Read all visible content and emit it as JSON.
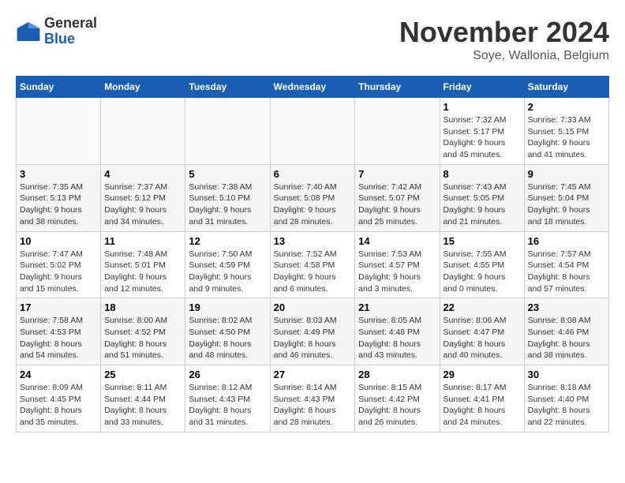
{
  "logo": {
    "general": "General",
    "blue": "Blue"
  },
  "title": "November 2024",
  "location": "Soye, Wallonia, Belgium",
  "days_of_week": [
    "Sunday",
    "Monday",
    "Tuesday",
    "Wednesday",
    "Thursday",
    "Friday",
    "Saturday"
  ],
  "weeks": [
    [
      {
        "day": "",
        "info": ""
      },
      {
        "day": "",
        "info": ""
      },
      {
        "day": "",
        "info": ""
      },
      {
        "day": "",
        "info": ""
      },
      {
        "day": "",
        "info": ""
      },
      {
        "day": "1",
        "info": "Sunrise: 7:32 AM\nSunset: 5:17 PM\nDaylight: 9 hours and 45 minutes."
      },
      {
        "day": "2",
        "info": "Sunrise: 7:33 AM\nSunset: 5:15 PM\nDaylight: 9 hours and 41 minutes."
      }
    ],
    [
      {
        "day": "3",
        "info": "Sunrise: 7:35 AM\nSunset: 5:13 PM\nDaylight: 9 hours and 38 minutes."
      },
      {
        "day": "4",
        "info": "Sunrise: 7:37 AM\nSunset: 5:12 PM\nDaylight: 9 hours and 34 minutes."
      },
      {
        "day": "5",
        "info": "Sunrise: 7:38 AM\nSunset: 5:10 PM\nDaylight: 9 hours and 31 minutes."
      },
      {
        "day": "6",
        "info": "Sunrise: 7:40 AM\nSunset: 5:08 PM\nDaylight: 9 hours and 28 minutes."
      },
      {
        "day": "7",
        "info": "Sunrise: 7:42 AM\nSunset: 5:07 PM\nDaylight: 9 hours and 25 minutes."
      },
      {
        "day": "8",
        "info": "Sunrise: 7:43 AM\nSunset: 5:05 PM\nDaylight: 9 hours and 21 minutes."
      },
      {
        "day": "9",
        "info": "Sunrise: 7:45 AM\nSunset: 5:04 PM\nDaylight: 9 hours and 18 minutes."
      }
    ],
    [
      {
        "day": "10",
        "info": "Sunrise: 7:47 AM\nSunset: 5:02 PM\nDaylight: 9 hours and 15 minutes."
      },
      {
        "day": "11",
        "info": "Sunrise: 7:48 AM\nSunset: 5:01 PM\nDaylight: 9 hours and 12 minutes."
      },
      {
        "day": "12",
        "info": "Sunrise: 7:50 AM\nSunset: 4:59 PM\nDaylight: 9 hours and 9 minutes."
      },
      {
        "day": "13",
        "info": "Sunrise: 7:52 AM\nSunset: 4:58 PM\nDaylight: 9 hours and 6 minutes."
      },
      {
        "day": "14",
        "info": "Sunrise: 7:53 AM\nSunset: 4:57 PM\nDaylight: 9 hours and 3 minutes."
      },
      {
        "day": "15",
        "info": "Sunrise: 7:55 AM\nSunset: 4:55 PM\nDaylight: 9 hours and 0 minutes."
      },
      {
        "day": "16",
        "info": "Sunrise: 7:57 AM\nSunset: 4:54 PM\nDaylight: 8 hours and 57 minutes."
      }
    ],
    [
      {
        "day": "17",
        "info": "Sunrise: 7:58 AM\nSunset: 4:53 PM\nDaylight: 8 hours and 54 minutes."
      },
      {
        "day": "18",
        "info": "Sunrise: 8:00 AM\nSunset: 4:52 PM\nDaylight: 8 hours and 51 minutes."
      },
      {
        "day": "19",
        "info": "Sunrise: 8:02 AM\nSunset: 4:50 PM\nDaylight: 8 hours and 48 minutes."
      },
      {
        "day": "20",
        "info": "Sunrise: 8:03 AM\nSunset: 4:49 PM\nDaylight: 8 hours and 46 minutes."
      },
      {
        "day": "21",
        "info": "Sunrise: 8:05 AM\nSunset: 4:48 PM\nDaylight: 8 hours and 43 minutes."
      },
      {
        "day": "22",
        "info": "Sunrise: 8:06 AM\nSunset: 4:47 PM\nDaylight: 8 hours and 40 minutes."
      },
      {
        "day": "23",
        "info": "Sunrise: 8:08 AM\nSunset: 4:46 PM\nDaylight: 8 hours and 38 minutes."
      }
    ],
    [
      {
        "day": "24",
        "info": "Sunrise: 8:09 AM\nSunset: 4:45 PM\nDaylight: 8 hours and 35 minutes."
      },
      {
        "day": "25",
        "info": "Sunrise: 8:11 AM\nSunset: 4:44 PM\nDaylight: 8 hours and 33 minutes."
      },
      {
        "day": "26",
        "info": "Sunrise: 8:12 AM\nSunset: 4:43 PM\nDaylight: 8 hours and 31 minutes."
      },
      {
        "day": "27",
        "info": "Sunrise: 8:14 AM\nSunset: 4:43 PM\nDaylight: 8 hours and 28 minutes."
      },
      {
        "day": "28",
        "info": "Sunrise: 8:15 AM\nSunset: 4:42 PM\nDaylight: 8 hours and 26 minutes."
      },
      {
        "day": "29",
        "info": "Sunrise: 8:17 AM\nSunset: 4:41 PM\nDaylight: 8 hours and 24 minutes."
      },
      {
        "day": "30",
        "info": "Sunrise: 8:18 AM\nSunset: 4:40 PM\nDaylight: 8 hours and 22 minutes."
      }
    ]
  ]
}
